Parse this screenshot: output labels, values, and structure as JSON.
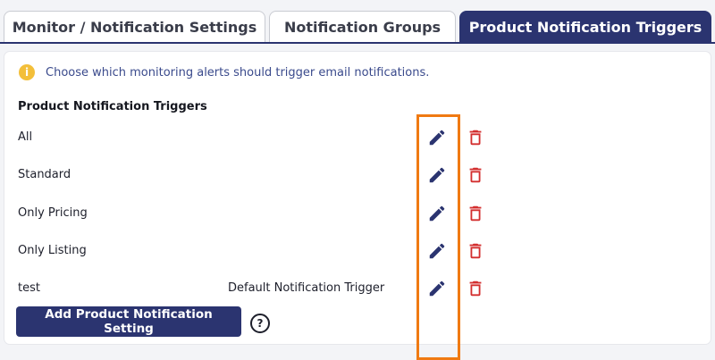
{
  "tabs": [
    {
      "label": "Monitor / Notification Settings",
      "active": false
    },
    {
      "label": "Notification Groups",
      "active": false
    },
    {
      "label": "Product Notification Triggers",
      "active": true
    }
  ],
  "info": {
    "text": "Choose which monitoring alerts should trigger email notifications."
  },
  "section": {
    "title": "Product Notification Triggers"
  },
  "triggers": [
    {
      "name": "All",
      "extra": ""
    },
    {
      "name": "Standard",
      "extra": ""
    },
    {
      "name": "Only Pricing",
      "extra": ""
    },
    {
      "name": "Only Listing",
      "extra": ""
    },
    {
      "name": "test",
      "extra": "Default Notification Trigger"
    }
  ],
  "add_button": {
    "label": "Add Product Notification Setting"
  },
  "icons": {
    "info": "info-icon",
    "edit": "pencil-icon",
    "delete": "trash-icon",
    "help": "help-circle-icon"
  },
  "colors": {
    "primary": "#2b3470",
    "delete": "#d32f2f",
    "highlight": "#f07a12",
    "info": "#f3bf3a"
  }
}
